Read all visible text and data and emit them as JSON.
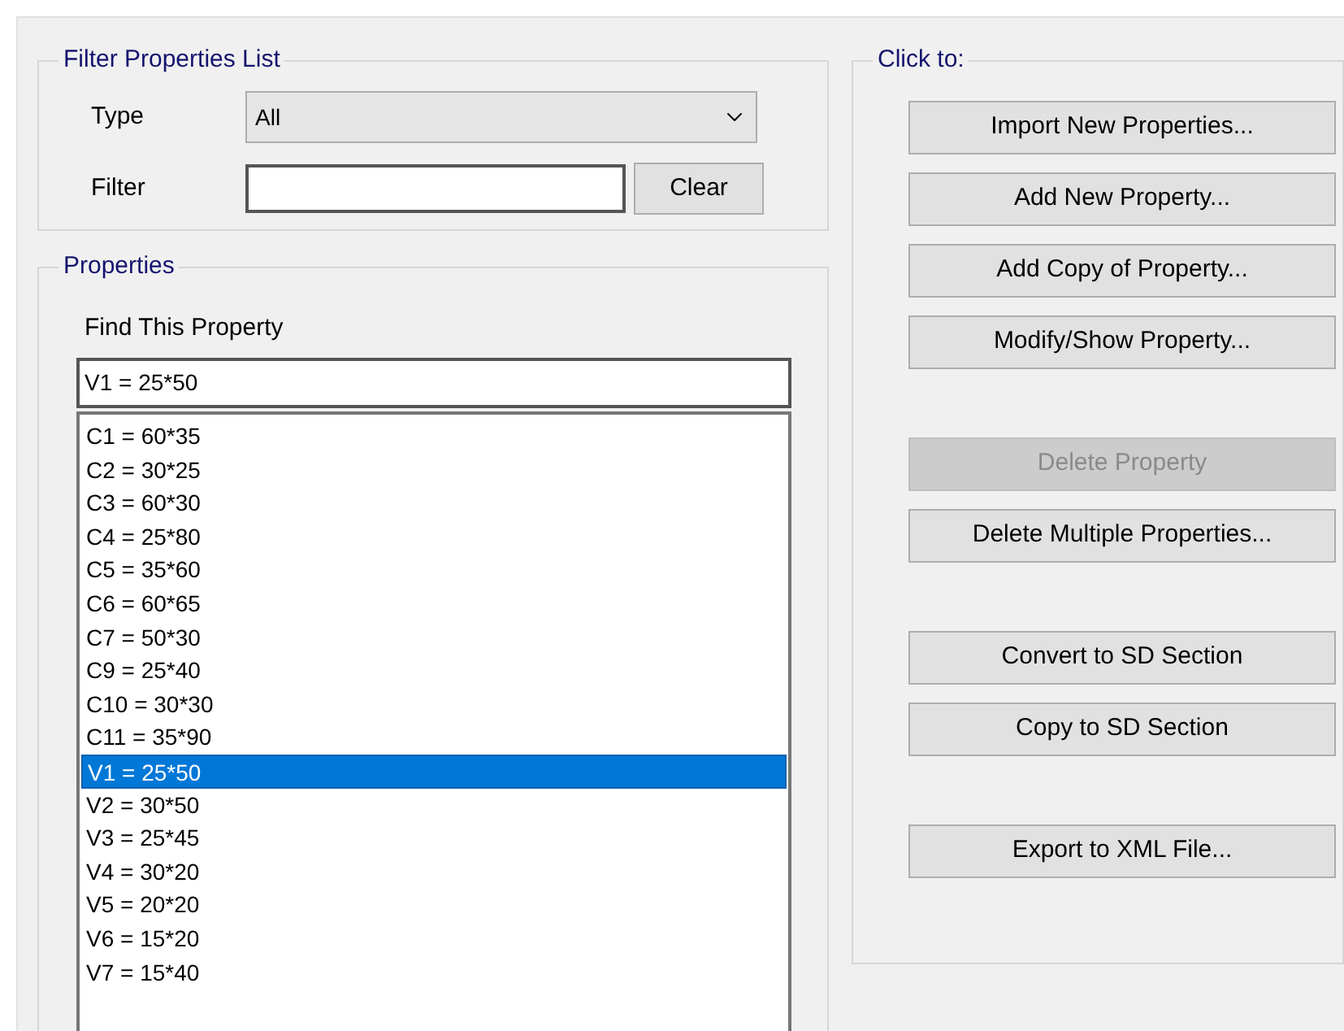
{
  "filter_group": {
    "title": "Filter Properties List",
    "type_label": "Type",
    "type_value": "All",
    "filter_label": "Filter",
    "clear_button": "Clear"
  },
  "properties_group": {
    "title": "Properties",
    "find_label": "Find This Property",
    "find_value": "V1 = 25*50",
    "items": [
      {
        "label": "C1 = 60*35",
        "selected": false
      },
      {
        "label": "C2 = 30*25",
        "selected": false
      },
      {
        "label": "C3 = 60*30",
        "selected": false
      },
      {
        "label": "C4 = 25*80",
        "selected": false
      },
      {
        "label": "C5 = 35*60",
        "selected": false
      },
      {
        "label": "C6 = 60*65",
        "selected": false
      },
      {
        "label": "C7 = 50*30",
        "selected": false
      },
      {
        "label": "C9 = 25*40",
        "selected": false
      },
      {
        "label": "C10 = 30*30",
        "selected": false
      },
      {
        "label": "C11 = 35*90",
        "selected": false
      },
      {
        "label": "V1 = 25*50",
        "selected": true
      },
      {
        "label": "V2 = 30*50",
        "selected": false
      },
      {
        "label": "V3 = 25*45",
        "selected": false
      },
      {
        "label": "V4 = 30*20",
        "selected": false
      },
      {
        "label": "V5 = 20*20",
        "selected": false
      },
      {
        "label": "V6 = 15*20",
        "selected": false
      },
      {
        "label": "V7 = 15*40",
        "selected": false
      }
    ]
  },
  "actions_group": {
    "title": "Click to:",
    "button_groups": [
      [
        {
          "label": "Import New Properties...",
          "disabled": false
        },
        {
          "label": "Add New Property...",
          "disabled": false
        },
        {
          "label": "Add Copy of Property...",
          "disabled": false
        },
        {
          "label": "Modify/Show Property...",
          "disabled": false
        }
      ],
      [
        {
          "label": "Delete Property",
          "disabled": true
        },
        {
          "label": "Delete Multiple Properties...",
          "disabled": false
        }
      ],
      [
        {
          "label": "Convert to SD Section",
          "disabled": false
        },
        {
          "label": "Copy to SD Section",
          "disabled": false
        }
      ],
      [
        {
          "label": "Export to XML File...",
          "disabled": false
        }
      ]
    ]
  }
}
